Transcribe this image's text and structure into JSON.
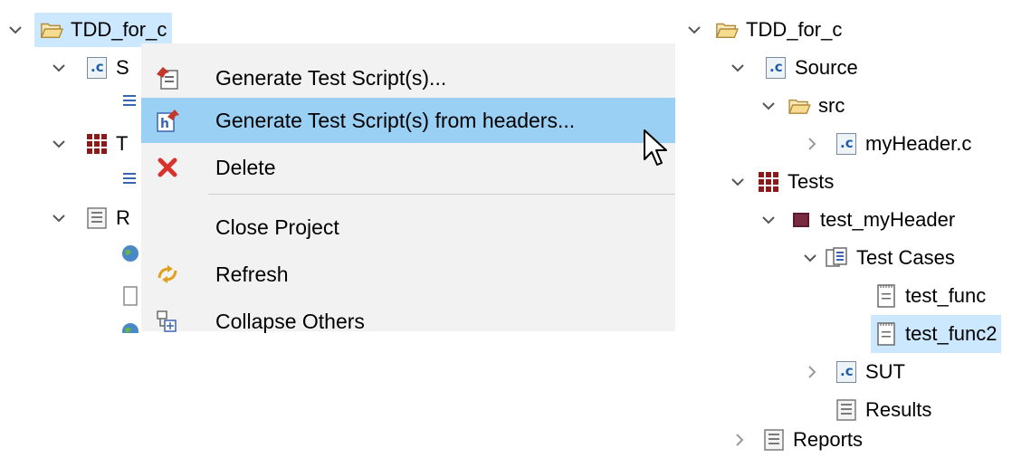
{
  "left_tree": {
    "root_label": "TDD_for_c",
    "row1_label": "S",
    "row2_label": "T",
    "row3_label": "R"
  },
  "context_menu": {
    "items": [
      {
        "label": "Generate Test Script(s)...",
        "icon": "generate-script-icon"
      },
      {
        "label": "Generate Test Script(s) from headers...",
        "icon": "generate-from-headers-icon",
        "highlighted": true
      },
      {
        "label": "Delete",
        "icon": "delete-icon"
      },
      {
        "label": "Close Project",
        "icon": ""
      },
      {
        "label": "Refresh",
        "icon": "refresh-icon"
      },
      {
        "label": "Collapse Others",
        "icon": "collapse-icon"
      }
    ]
  },
  "right_tree": {
    "root_label": "TDD_for_c",
    "source_label": "Source",
    "src_label": "src",
    "myheader_label": "myHeader.c",
    "tests_label": "Tests",
    "test_myheader_label": "test_myHeader",
    "test_cases_label": "Test Cases",
    "test_func_label": "test_func",
    "test_func2_label": "test_func2",
    "sut_label": "SUT",
    "results_label": "Results",
    "reports_label": "Reports"
  },
  "colors": {
    "selection": "#cce8ff",
    "menu_highlight": "#9bd0f5",
    "menu_background": "#f2f2f2"
  }
}
